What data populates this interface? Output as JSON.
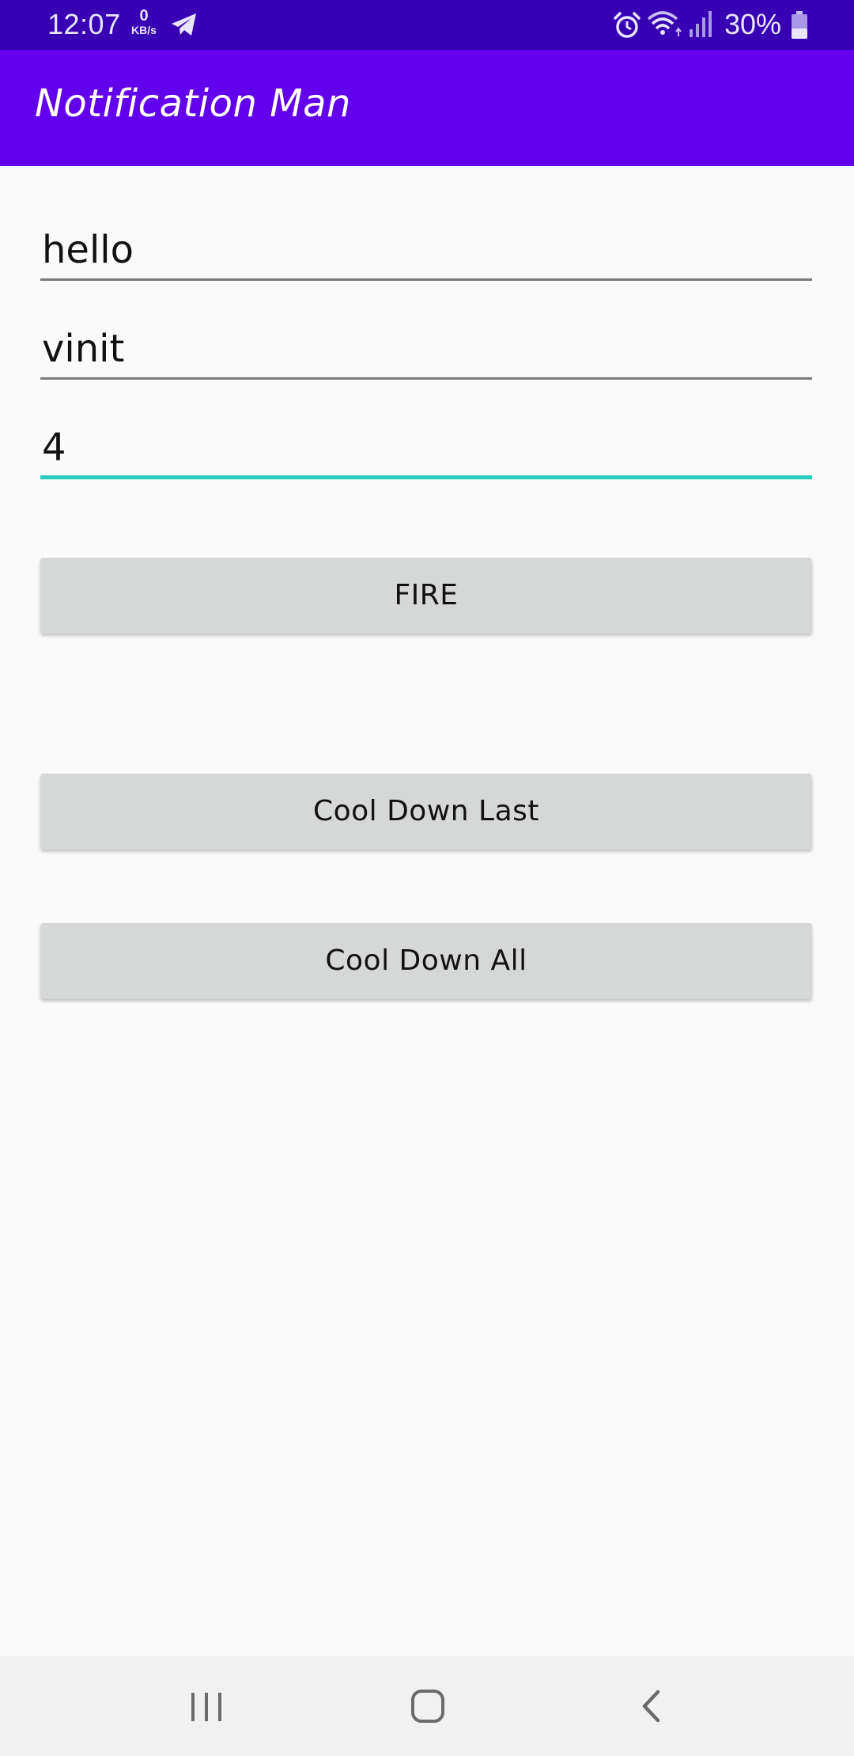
{
  "status_bar": {
    "time": "12:07",
    "net_speed_value": "0",
    "net_speed_unit": "KB/s",
    "battery_text": "30%",
    "icons": [
      "telegram-icon",
      "alarm-icon",
      "wifi-icon",
      "signal-icon",
      "battery-icon"
    ]
  },
  "app_bar": {
    "title": "Notification Man"
  },
  "form": {
    "field1_value": "hello",
    "field2_value": "vinit",
    "field3_value": "4"
  },
  "buttons": {
    "fire": "FIRE",
    "cool_down_last": "Cool Down Last",
    "cool_down_all": "Cool Down All"
  },
  "nav_bar": {
    "icons": [
      "recents-icon",
      "home-icon",
      "back-icon"
    ]
  },
  "colors": {
    "status_bar": "#3700b3",
    "app_bar": "#6200ee",
    "focused_accent": "#26cdbf",
    "button_bg": "#d6d7d7",
    "background": "#fafafa"
  }
}
